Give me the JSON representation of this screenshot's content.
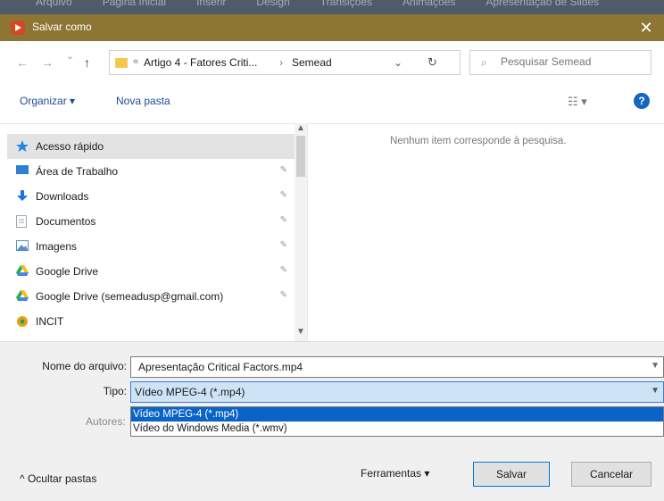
{
  "background_menu": [
    "Arquivo",
    "Página Inicial",
    "Inserir",
    "Design",
    "Transições",
    "Animações",
    "Apresentação de Slides"
  ],
  "window": {
    "title": "Salvar como",
    "close_glyph": "✕"
  },
  "address": {
    "back_glyph": "←",
    "forward_glyph": "→",
    "up_glyph": "↑",
    "chevrons": "«",
    "crumb1": "Artigo 4 - Fatores Criti...",
    "separator": "›",
    "crumb2": "Semead",
    "dropdown_glyph": "⌄",
    "refresh_glyph": "↻"
  },
  "search": {
    "placeholder": "Pesquisar Semead",
    "icon": "search-icon"
  },
  "toolbar": {
    "organize": "Organizar ▾",
    "new_folder": "Nova pasta",
    "view_glyph": "☷ ▾",
    "help": "?"
  },
  "nav": {
    "items": [
      {
        "label": "Acesso rápido",
        "icon": "star-icon",
        "color": "#1e88e5",
        "pinned": false,
        "selected": true
      },
      {
        "label": "Área de Trabalho",
        "icon": "desktop-icon",
        "color": "#2f80d1",
        "pinned": true
      },
      {
        "label": "Downloads",
        "icon": "download-icon",
        "color": "#1a73e8",
        "pinned": true
      },
      {
        "label": "Documentos",
        "icon": "document-icon",
        "color": "#9aa6b2",
        "pinned": true
      },
      {
        "label": "Imagens",
        "icon": "image-icon",
        "color": "#5b8ec7",
        "pinned": true
      },
      {
        "label": "Google Drive",
        "icon": "google-drive-icon",
        "color": "#34a853",
        "pinned": true
      },
      {
        "label": "Google Drive (semeadusp@gmail.com)",
        "icon": "google-drive-icon",
        "color": "#34a853",
        "pinned": true
      },
      {
        "label": "INCIT",
        "icon": "incit-icon",
        "color": "#e3a21a",
        "pinned": false
      }
    ],
    "pin_glyph": "✎"
  },
  "content": {
    "empty_message": "Nenhum item corresponde à pesquisa."
  },
  "form": {
    "filename_label": "Nome do arquivo:",
    "filename_value": "Apresentação Critical Factors.mp4",
    "type_label": "Tipo:",
    "type_value": "Vídeo MPEG-4 (*.mp4)",
    "type_options": [
      "Vídeo MPEG-4 (*.mp4)",
      "Vídeo do Windows Media (*.wmv)"
    ],
    "authors_label": "Autores:"
  },
  "bottom": {
    "hide_folders": "^  Ocultar pastas",
    "tools": "Ferramentas  ▾",
    "save": "Salvar",
    "cancel": "Cancelar"
  }
}
